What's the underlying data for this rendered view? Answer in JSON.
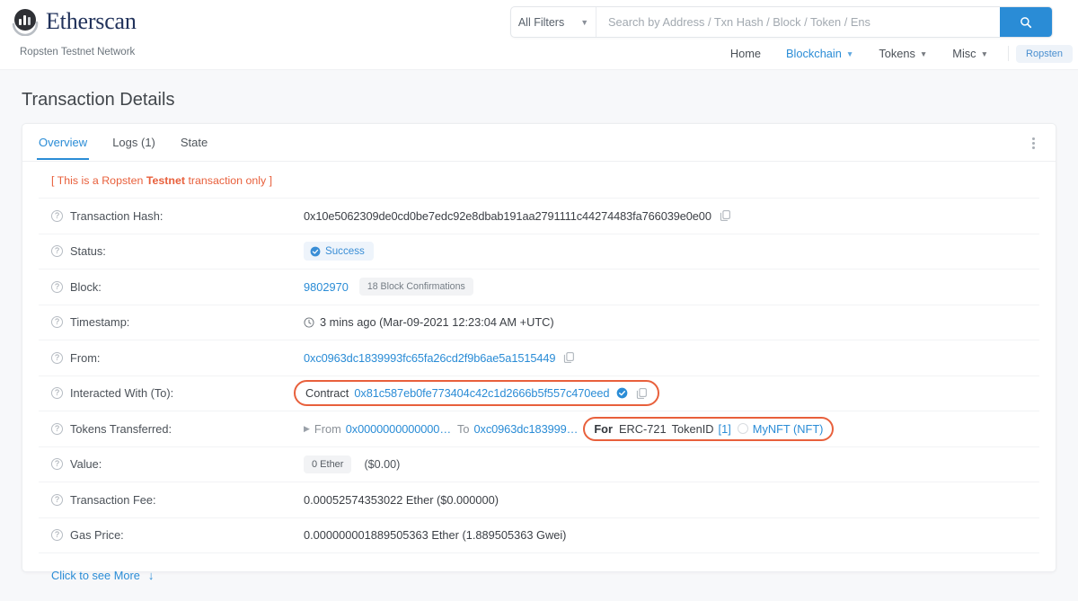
{
  "header": {
    "brand_name": "Etherscan",
    "network_subtitle": "Ropsten Testnet Network",
    "filters_label": "All Filters",
    "search_placeholder": "Search by Address / Txn Hash / Block / Token / Ens",
    "search_value": "",
    "nav": [
      {
        "label": "Home",
        "has_caret": false,
        "active": false
      },
      {
        "label": "Blockchain",
        "has_caret": true,
        "active": true
      },
      {
        "label": "Tokens",
        "has_caret": true,
        "active": false
      },
      {
        "label": "Misc",
        "has_caret": true,
        "active": false
      }
    ],
    "network_badge": "Ropsten"
  },
  "page": {
    "title": "Transaction Details"
  },
  "tabs": [
    {
      "label": "Overview",
      "active": true
    },
    {
      "label": "Logs (1)",
      "active": false
    },
    {
      "label": "State",
      "active": false
    }
  ],
  "notice": {
    "prefix": "[ This is a Ropsten ",
    "bold": "Testnet",
    "suffix": " transaction only ]"
  },
  "rows": {
    "transaction_hash": {
      "label": "Transaction Hash:",
      "value": "0x10e5062309de0cd0be7edc92e8dbab191aa2791111c44274483fa766039e0e00"
    },
    "status": {
      "label": "Status:",
      "value": "Success"
    },
    "block": {
      "label": "Block:",
      "number": "9802970",
      "confirmations": "18 Block Confirmations"
    },
    "timestamp": {
      "label": "Timestamp:",
      "value": "3 mins ago (Mar-09-2021 12:23:04 AM +UTC)"
    },
    "from": {
      "label": "From:",
      "value": "0xc0963dc1839993fc65fa26cd2f9b6ae5a1515449"
    },
    "interacted_with": {
      "label": "Interacted With (To):",
      "contract_word": "Contract",
      "address": "0x81c587eb0fe773404c42c1d2666b5f557c470eed"
    },
    "tokens_transferred": {
      "label": "Tokens Transferred:",
      "from_word": "From",
      "from_address": "0x0000000000000…",
      "to_word": "To",
      "to_address": "0xc0963dc183999…",
      "for_word": "For",
      "token_standard": "ERC-721",
      "token_id_label": "TokenID",
      "token_id": "[1]",
      "token_name": "MyNFT (NFT)"
    },
    "value": {
      "label": "Value:",
      "amount": "0 Ether",
      "usd": "($0.00)"
    },
    "transaction_fee": {
      "label": "Transaction Fee:",
      "value": "0.00052574353022 Ether ($0.000000)"
    },
    "gas_price": {
      "label": "Gas Price:",
      "value": "0.000000001889505363 Ether (1.889505363 Gwei)"
    }
  },
  "footer": {
    "more_label": "Click to see More",
    "arrow": "↓"
  },
  "icons": {
    "help": "?",
    "caret": "▾"
  },
  "colors": {
    "accent": "#2a8cd6",
    "testnet_red": "#e8603c",
    "highlight_box": "#e8603c",
    "brand_dark": "#21325b"
  }
}
